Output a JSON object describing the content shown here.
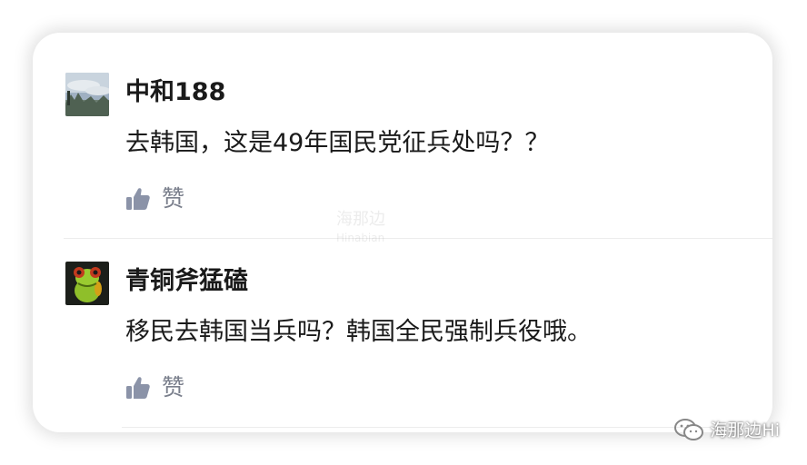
{
  "comments": [
    {
      "username": "中和188",
      "text": "去韩国，这是49年国民党征兵处吗？？",
      "like_label": "赞",
      "avatar": "landscape-avatar"
    },
    {
      "username": "青铜斧猛磕",
      "text": "移民去韩国当兵吗？韩国全民强制兵役哦。",
      "like_label": "赞",
      "avatar": "frog-avatar"
    }
  ],
  "watermarks": {
    "center_main": "海那边",
    "center_sub": "Hinabian",
    "corner": "海那边Hi"
  },
  "colors": {
    "text": "#1a1a1a",
    "like_icon": "#8b93a8",
    "like_label": "#7a7f8c",
    "divider": "#ececec"
  }
}
